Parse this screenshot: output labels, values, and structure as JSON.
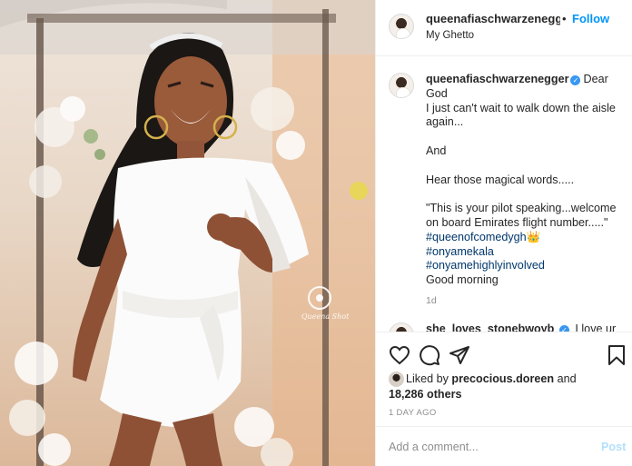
{
  "post": {
    "image_alt": "Woman in white outfit posing outdoors",
    "watermark": "Queena Shot"
  },
  "header": {
    "username": "queenafiaschwarzenegger",
    "dot": "•",
    "follow_label": "Follow",
    "location": "My Ghetto"
  },
  "caption": {
    "username": "queenafiaschwarzenegger",
    "verified_glyph": "✓",
    "first_line": "Dear",
    "lines_block1": [
      "God",
      "I just can't wait to walk down the aisle",
      "again..."
    ],
    "line_and": "And",
    "line_hear": "Hear those magical words.....",
    "quote_lines": [
      "\"This is your pilot speaking...welcome",
      "on board Emirates flight number.....\""
    ],
    "hashtags": [
      "#queenofcomedygh👑",
      "#onyamekala",
      "#onyamehighlyinvolved"
    ],
    "closing": "Good morning",
    "time": "1d"
  },
  "next_comment": {
    "username": "she_loves_stonebwoyb",
    "text": "I love ur"
  },
  "actions": {
    "like_icon": "heart-icon",
    "comment_icon": "comment-icon",
    "share_icon": "paper-plane-icon",
    "save_icon": "bookmark-icon"
  },
  "likes": {
    "prefix": "Liked by",
    "by_user": "precocious.doreen",
    "conj": "and",
    "count": "18,286 others"
  },
  "date": "1 DAY AGO",
  "comment_box": {
    "placeholder": "Add a comment...",
    "post_label": "Post"
  },
  "colors": {
    "link_blue": "#0095f6",
    "hashtag": "#00376b",
    "muted": "#8e8e8e",
    "verified": "#3897f0",
    "post_disabled": "#b2dffc"
  }
}
